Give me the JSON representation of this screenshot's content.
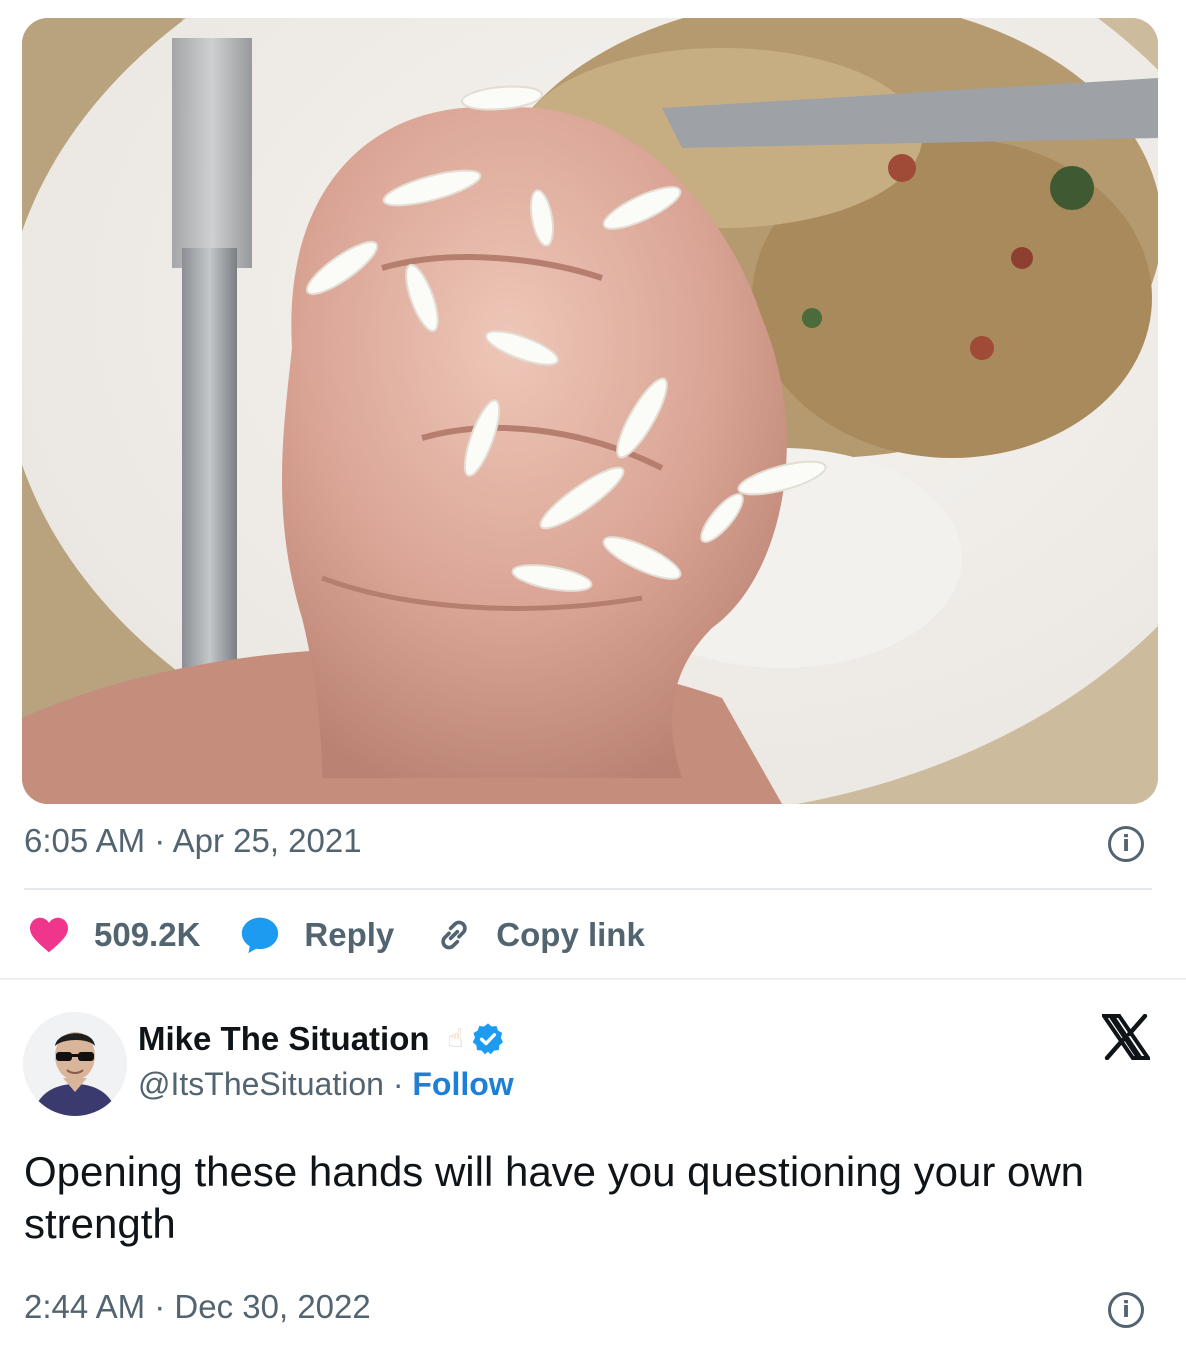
{
  "photo": {
    "alt": "Baby hand gripping rice over a plate of food"
  },
  "tweet1": {
    "time": "6:05 AM",
    "date": "Apr 25, 2021",
    "likes": "509.2K",
    "reply_label": "Reply",
    "copy_label": "Copy link"
  },
  "tweet2": {
    "author_name": "Mike The Situation",
    "author_emoji": "☝",
    "handle": "@ItsTheSituation",
    "separator": "·",
    "follow_label": "Follow",
    "text": "Opening these hands will have you questioning your own strength",
    "time": "2:44 AM",
    "date": "Dec 30, 2022"
  },
  "colors": {
    "heart": "#f0358c",
    "reply_bubble": "#1d9bf0",
    "follow": "#1d7fd8",
    "verified": "#1d9bf0",
    "muted_text": "#536471"
  },
  "icons": [
    "heart-icon",
    "reply-bubble-icon",
    "link-icon",
    "info-icon",
    "verified-badge-icon",
    "x-logo-icon"
  ]
}
